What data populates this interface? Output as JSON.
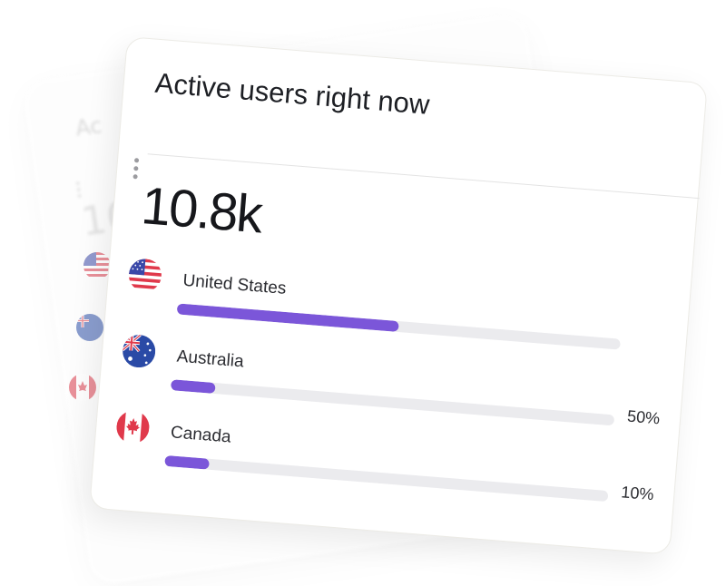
{
  "card": {
    "title": "Active users right now",
    "total_value": "10.8k"
  },
  "countries": [
    {
      "name": "United States",
      "percent_label": "",
      "fill_fraction": 0.5,
      "flag": "us-flag-icon"
    },
    {
      "name": "Australia",
      "percent_label": "50%",
      "fill_fraction": 0.1,
      "flag": "australia-flag-icon"
    },
    {
      "name": "Canada",
      "percent_label": "10%",
      "fill_fraction": 0.1,
      "flag": "canada-flag-icon"
    }
  ],
  "colors": {
    "accent": "#7b56d9",
    "track": "#ebebee",
    "text": "#1d1f24"
  },
  "background_card": {
    "title_fragment": "Ac",
    "value_fragment": "10"
  }
}
